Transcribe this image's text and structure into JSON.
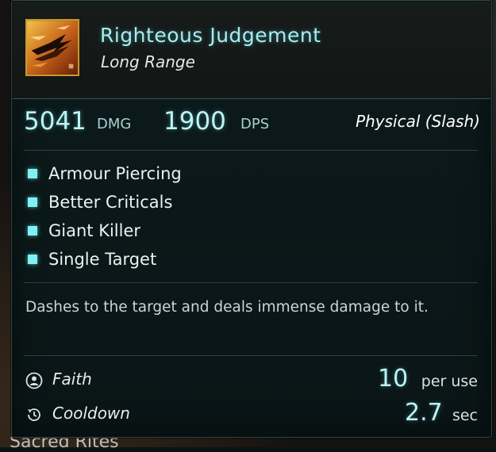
{
  "skill": {
    "name": "Righteous Judgement",
    "range": "Long Range",
    "icon": "slash-attack-icon"
  },
  "stats": {
    "damage_value": "5041",
    "damage_unit": "DMG",
    "dps_value": "1900",
    "dps_unit": "DPS",
    "damage_type": "Physical (Slash)"
  },
  "traits": [
    {
      "label": "Armour Piercing"
    },
    {
      "label": "Better Criticals"
    },
    {
      "label": "Giant Killer"
    },
    {
      "label": "Single Target"
    }
  ],
  "description": "Dashes to the target and deals immense damage to it.",
  "costs": {
    "faith": {
      "label": "Faith",
      "value": "10",
      "unit": "per use",
      "icon": "faith-icon"
    },
    "cooldown": {
      "label": "Cooldown",
      "value": "2.7",
      "unit": "sec",
      "icon": "cooldown-icon"
    }
  },
  "background_text": "Sacred Rites",
  "colors": {
    "accent": "#a8ecee",
    "bullet": "#7ff1f2",
    "icon_border": "#c89a2a"
  }
}
